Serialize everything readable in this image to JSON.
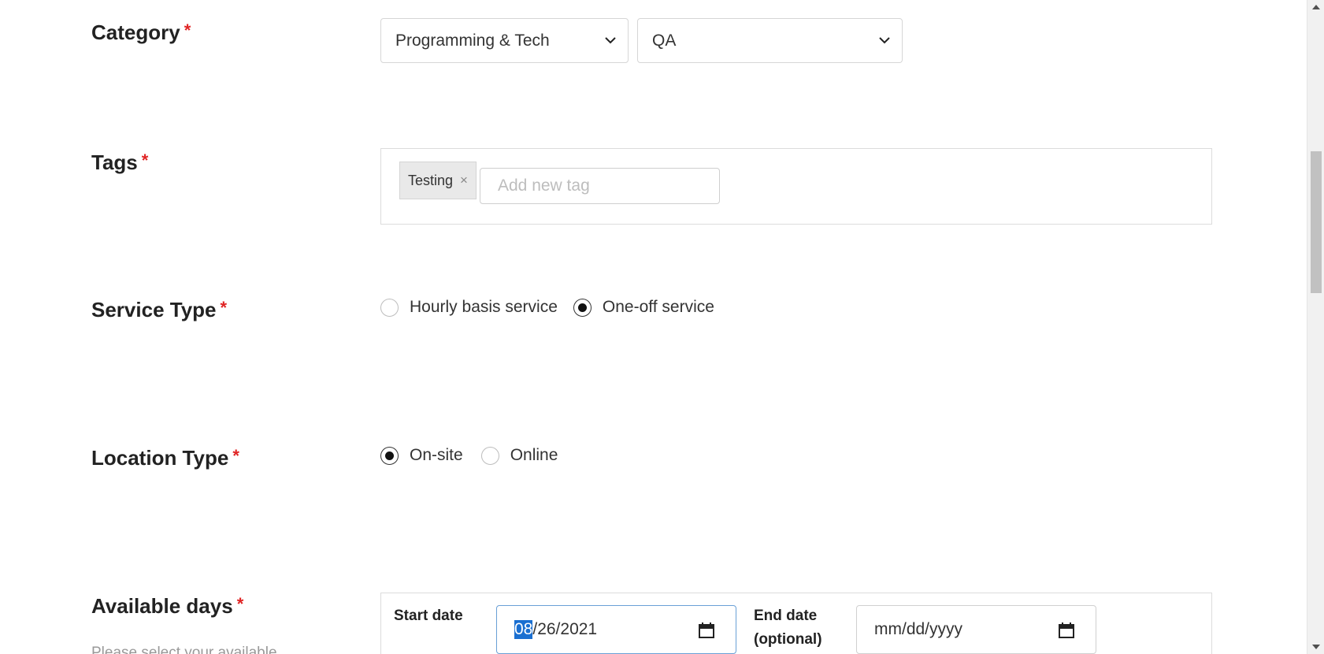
{
  "category": {
    "label": "Category",
    "required_mark": "*",
    "primary_select": "Programming & Tech",
    "secondary_select": "QA"
  },
  "tags": {
    "label": "Tags",
    "required_mark": "*",
    "chips": [
      {
        "text": "Testing",
        "remove": "×"
      }
    ],
    "input_placeholder": "Add new tag"
  },
  "service_type": {
    "label": "Service Type",
    "required_mark": "*",
    "options": [
      {
        "label": "Hourly basis service",
        "checked": false
      },
      {
        "label": "One-off service",
        "checked": true
      }
    ]
  },
  "location_type": {
    "label": "Location Type",
    "required_mark": "*",
    "options": [
      {
        "label": "On-site",
        "checked": true
      },
      {
        "label": "Online",
        "checked": false
      }
    ]
  },
  "available_days": {
    "label": "Available days",
    "required_mark": "*",
    "start_label": "Start date",
    "start_value_selected": "08",
    "start_value_rest": "/26/2021",
    "end_label_line1": "End date",
    "end_label_line2": "(optional)",
    "end_placeholder": "mm/dd/yyyy",
    "hint": "Please select your available"
  },
  "icons": {
    "select_chevron": "chevron-down-icon",
    "calendar": "calendar-icon",
    "remove_tag": "close-icon"
  }
}
